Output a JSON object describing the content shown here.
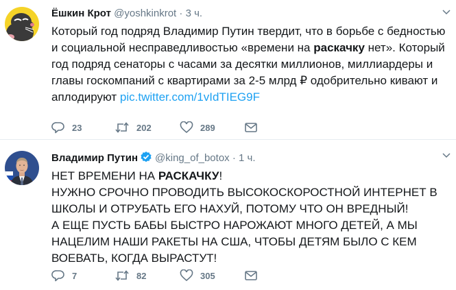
{
  "tweets": [
    {
      "name": "Ёшкин Крот",
      "handle": "@yoshkinkrot",
      "separator": "·",
      "time": "3 ч.",
      "body_part1": "Который год подряд Владимир Путин твердит, что в борьбе с бедностью и социальной несправедливостью «времени на ",
      "body_bold": "раскачку",
      "body_part2": " нет». Который год подряд сенаторы с часами за десятки миллионов, миллиардеры и главы госкомпаний с квартирами за 2-5 млрд ₽ одобрительно кивают и аплодируют ",
      "link": "pic.twitter.com/1vIdTIEG9F",
      "replies": "23",
      "retweets": "202",
      "likes": "289"
    },
    {
      "name": "Владимир Путин",
      "handle": "@king_of_botox",
      "separator": "·",
      "time": "1 ч.",
      "line1_part1": "НЕТ ВРЕМЕНИ НА ",
      "line1_bold": "РАСКАЧКУ",
      "line1_part2": "!",
      "paragraph2": "НУЖНО СРОЧНО ПРОВОДИТЬ ВЫСОКОСКОРОСТНОЙ ИНТЕРНЕТ В ШКОЛЫ И ОТРУБАТЬ ЕГО НАХУЙ, ПОТОМУ ЧТО ОН ВРЕДНЫЙ!",
      "paragraph3": "А ЕЩЕ ПУСТЬ БАБЫ БЫСТРО НАРОЖАЮТ МНОГО ДЕТЕЙ, А МЫ НАЦЕЛИМ НАШИ РАКЕТЫ НА США, ЧТОБЫ ДЕТЯМ БЫЛО С КЕМ ВОЕВАТЬ, КОГДА ВЫРАСТУТ!",
      "replies": "7",
      "retweets": "82",
      "likes": "305"
    }
  ],
  "colors": {
    "text": "#14171a",
    "muted": "#657786",
    "link": "#1da1f2",
    "verified": "#1da1f2",
    "divider": "#e6ecf0",
    "mole_avatar_bg": "#f5d328"
  },
  "icons": {
    "reply": "reply-icon",
    "retweet": "retweet-icon",
    "like": "heart-icon",
    "message": "envelope-icon",
    "verified": "verified-badge-icon",
    "caret": "chevron-down-icon"
  }
}
